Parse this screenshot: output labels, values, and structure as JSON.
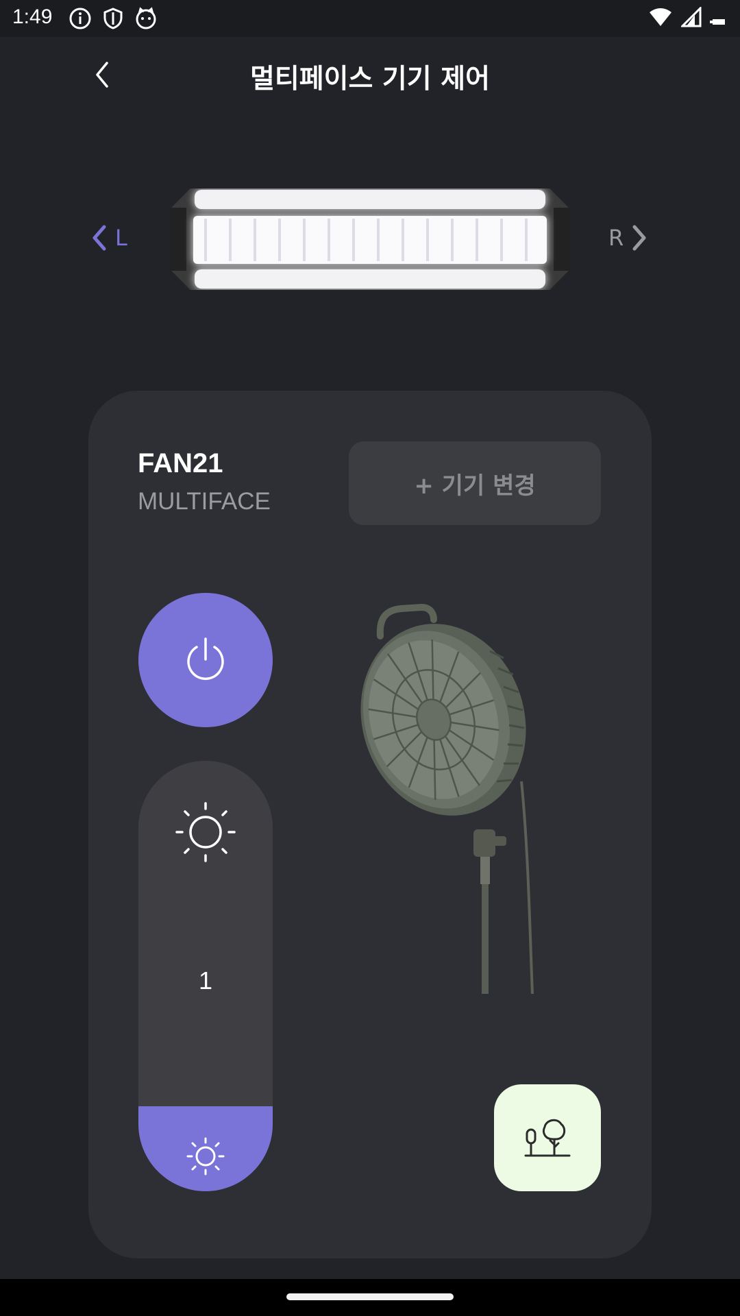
{
  "status_bar": {
    "time": "1:49",
    "icons_left": [
      "info-icon",
      "shield-icon",
      "cat-icon"
    ],
    "icons_right": [
      "wifi-icon",
      "signal-icon",
      "battery-icon"
    ]
  },
  "header": {
    "title": "멀티페이스 기기 제어",
    "back_icon": "chevron-left-icon"
  },
  "light_preview": {
    "left_label": "L",
    "right_label": "R",
    "accent_color": "#7a73d8"
  },
  "device": {
    "name": "FAN21",
    "model": "MULTIFACE",
    "change_button": "+ 기기 변경"
  },
  "controls": {
    "power_icon": "power-icon",
    "brightness_level": "1",
    "brightness_fill": 0.2,
    "scene_icon": "trees-icon"
  },
  "colors": {
    "accent": "#7a73d8",
    "background": "#222329",
    "card": "#2e2f34",
    "scene_button": "#eefbe4"
  }
}
